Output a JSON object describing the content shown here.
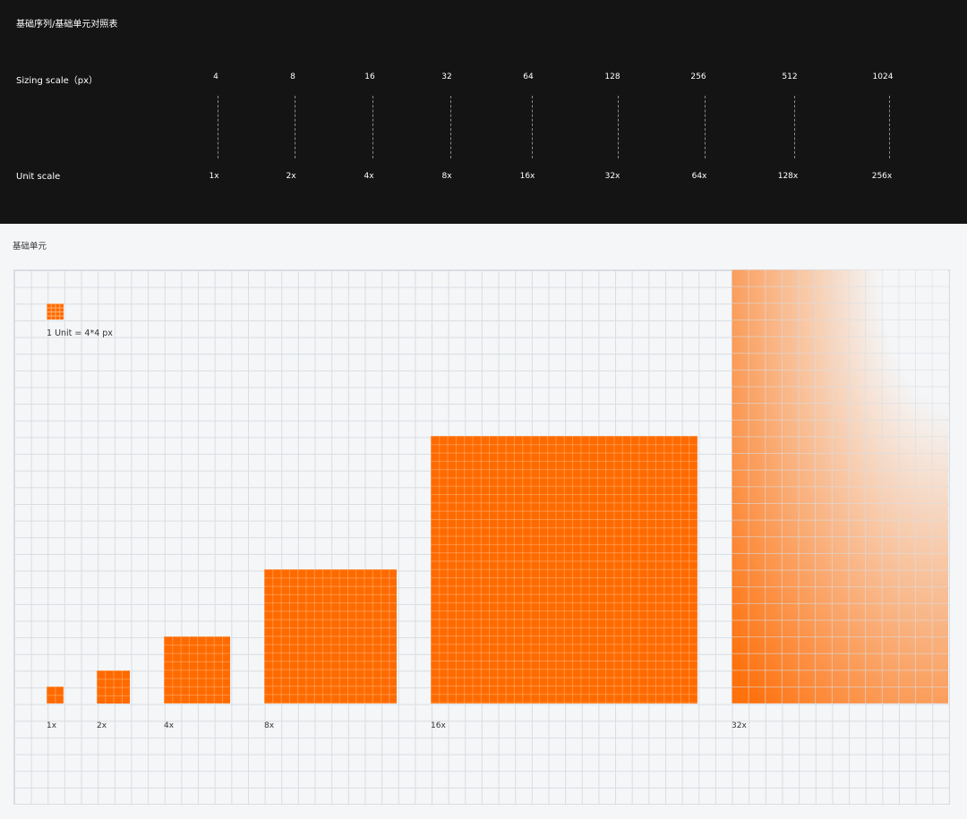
{
  "header": {
    "title": "基础序列/基础单元对照表"
  },
  "sizing": {
    "label": "Sizing scale（px）",
    "values": [
      "4",
      "8",
      "16",
      "32",
      "64",
      "128",
      "256",
      "512",
      "1024"
    ]
  },
  "unit_scale": {
    "label": "Unit scale",
    "values": [
      "1x",
      "2x",
      "4x",
      "8x",
      "16x",
      "32x",
      "64x",
      "128x",
      "256x"
    ]
  },
  "section": {
    "title": "基础单元"
  },
  "unit_demo": {
    "caption": "1 Unit = 4*4 px"
  },
  "blocks": [
    {
      "label": "1x"
    },
    {
      "label": "2x"
    },
    {
      "label": "4x"
    },
    {
      "label": "8x"
    },
    {
      "label": "16x"
    },
    {
      "label": "32x"
    }
  ],
  "colors": {
    "accent": "#ff6a00",
    "dark_bg": "#141414",
    "light_bg": "#f4f6f8",
    "grid": "#d9dde2"
  }
}
